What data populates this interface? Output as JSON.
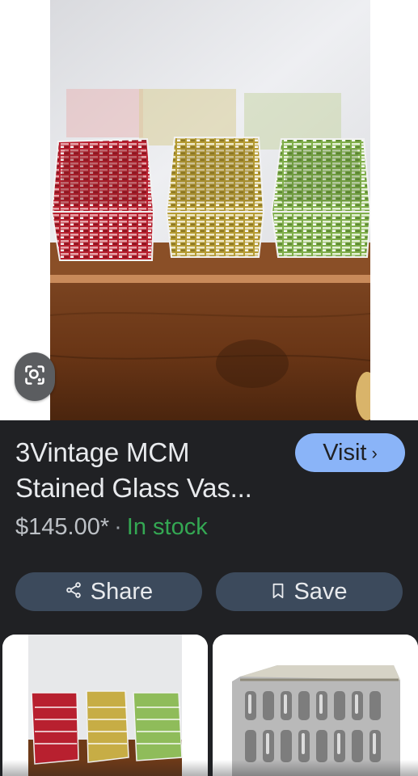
{
  "product": {
    "title_line1": "3Vintage MCM",
    "title_line2": "Stained Glass Vas...",
    "price": "$145.00*",
    "separator": "·",
    "availability": "In stock"
  },
  "actions": {
    "visit_label": "Visit",
    "visit_chevron": "›",
    "share_label": "Share",
    "save_label": "Save"
  },
  "hero_image": {
    "subject": "three mosaic stained glass vases (red, amber, green) on a wooden shelf"
  },
  "related_results": [
    {
      "subject": "three mosaic glass vases"
    },
    {
      "subject": "silver mercury glass cube vase"
    }
  ],
  "icons": [
    "lens-search-icon",
    "share-icon",
    "bookmark-icon",
    "chevron-right-icon"
  ],
  "colors": {
    "background": "#202124",
    "visit_button": "#8ab4f8",
    "pill_button": "#3c4a5c",
    "in_stock": "#34a853",
    "text_primary": "#e8eaed",
    "text_secondary": "#bdc1c6"
  }
}
